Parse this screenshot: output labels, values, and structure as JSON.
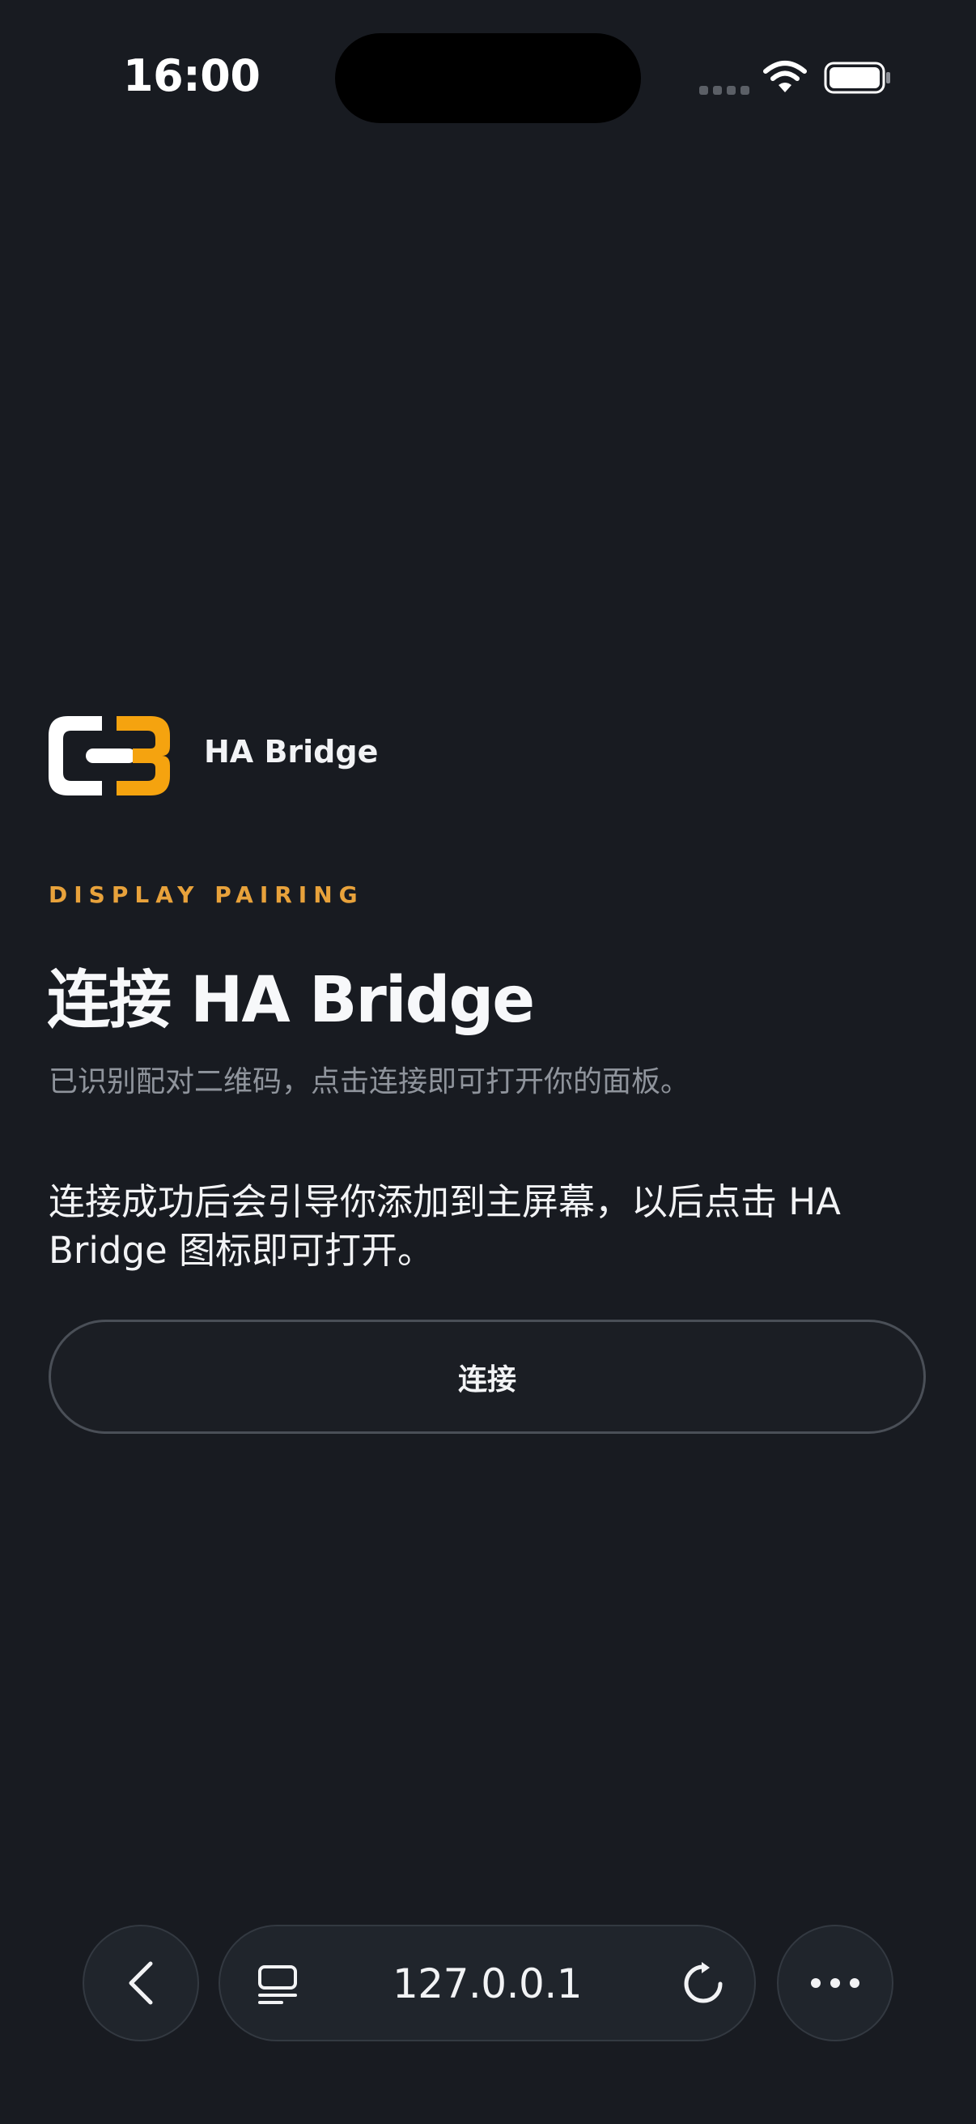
{
  "status_bar": {
    "time": "16:00",
    "icons": [
      "signal-dots-icon",
      "wifi-icon",
      "battery-icon"
    ]
  },
  "brand": {
    "name": "HA Bridge",
    "logo_icon": "chain-link-logo",
    "logo_colors": {
      "left": "#ffffff",
      "right": "#f5a30f"
    }
  },
  "content": {
    "eyebrow": "DISPLAY PAIRING",
    "title": "连接 HA Bridge",
    "subtitle": "已识别配对二维码，点击连接即可打开你的面板。",
    "body": "连接成功后会引导你添加到主屏幕，以后点击 HA Bridge 图标即可打开。",
    "connect_label": "连接"
  },
  "browser_bar": {
    "url": "127.0.0.1",
    "icons": [
      "back-chevron-icon",
      "reader-mode-icon",
      "reload-icon",
      "more-icon"
    ]
  },
  "colors": {
    "background": "#181b21",
    "accent": "#e8a23b",
    "text": "#f2f3f5",
    "muted_text": "#8f949c"
  }
}
